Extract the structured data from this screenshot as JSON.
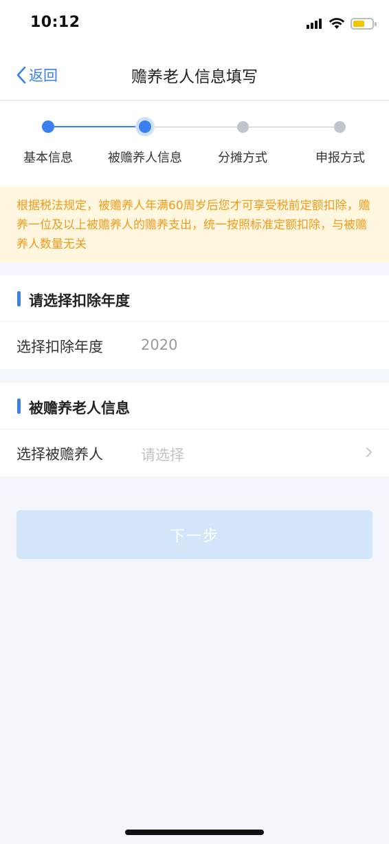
{
  "status_bar": {
    "time": "10:12",
    "colors": {
      "battery_fill": "#f5c400"
    }
  },
  "nav": {
    "back_label": "返回",
    "title": "赡养老人信息填写"
  },
  "steps": {
    "items": [
      {
        "label": "基本信息",
        "state": "done"
      },
      {
        "label": "被赡养人信息",
        "state": "current"
      },
      {
        "label": "分摊方式",
        "state": "pending"
      },
      {
        "label": "申报方式",
        "state": "pending"
      }
    ],
    "colors": {
      "active": "#3a7ff0",
      "inactive": "#c0c4cc"
    }
  },
  "notice": {
    "text": "根据税法规定，被赡养人年满60周岁后您才可享受税前定额扣除，赡养一位及以上被赡养人的赡养支出，统一按照标准定额扣除，与被赡养人数量无关"
  },
  "year_section": {
    "title": "请选择扣除年度",
    "row_label": "选择扣除年度",
    "row_value": "2020"
  },
  "elder_section": {
    "title": "被赡养老人信息",
    "row_label": "选择被赡养人",
    "row_placeholder": "请选择"
  },
  "next_button": {
    "label": "下一步"
  },
  "colors": {
    "accent": "#3a7ff0",
    "notice_text": "#f29a1a",
    "notice_bg": "#fff7e0",
    "button_disabled_bg": "#d3e5f9"
  }
}
